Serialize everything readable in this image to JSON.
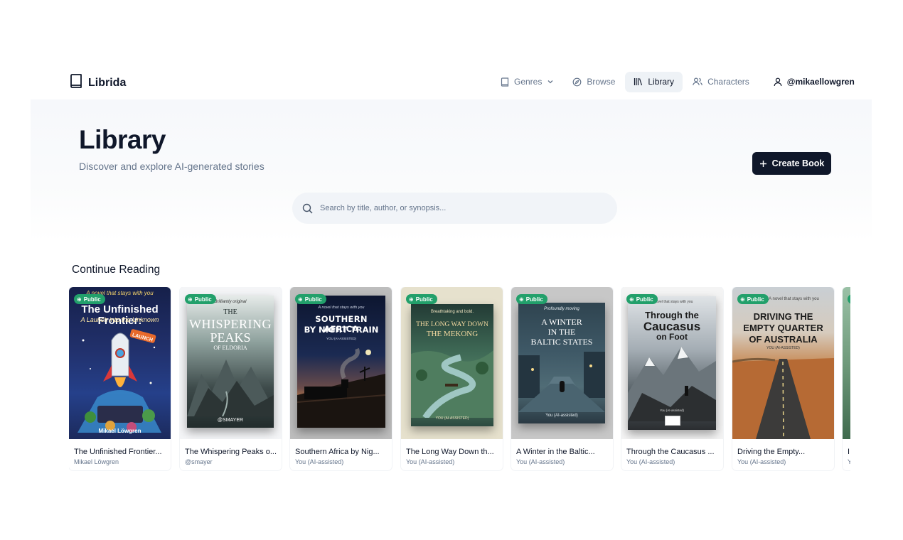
{
  "app": {
    "brand": "Librida"
  },
  "nav": {
    "genres": "Genres",
    "browse": "Browse",
    "library": "Library",
    "characters": "Characters",
    "user": "@mikaellowgren"
  },
  "hero": {
    "title": "Library",
    "subtitle": "Discover and explore AI-generated stories",
    "create_label": "Create Book"
  },
  "search": {
    "placeholder": "Search by title, author, or synopsis..."
  },
  "continue": {
    "heading": "Continue Reading"
  },
  "badge_label": "Public",
  "books": [
    {
      "title": "The Unfinished Frontier...",
      "author": "Mikael Löwgren",
      "cover": {
        "quote": "A novel that stays with you",
        "line1": "The Unfinished Frontier:",
        "line2": "A Launch into the Unknown",
        "tag": "LAUNCH",
        "footer": "Mikael Löwgren"
      }
    },
    {
      "title": "The Whispering Peaks o...",
      "author": "@smayer",
      "cover": {
        "quote": "Brilliantly original",
        "line1": "THE",
        "line2": "WHISPERING",
        "line3": "PEAKS",
        "line4": "OF ELDORIA",
        "footer": "@SMAYER"
      }
    },
    {
      "title": "Southern Africa by Nig...",
      "author": "You (AI-assisted)",
      "cover": {
        "quote": "A novel that stays with you",
        "line1": "SOUTHERN AFRICA",
        "line2": "BY NIGHT TRAIN",
        "footer": "YOU (AI-ASSISTED)"
      }
    },
    {
      "title": "The Long Way Down th...",
      "author": "You (AI-assisted)",
      "cover": {
        "quote": "Breathtaking and bold.",
        "line1": "THE LONG WAY DOWN",
        "line2": "THE MEKONG",
        "footer": "YOU (AI-ASSISTED)"
      }
    },
    {
      "title": "A Winter in the Baltic...",
      "author": "You (AI-assisted)",
      "cover": {
        "quote": "Profoundly moving",
        "line1": "A WINTER",
        "line2": "IN THE",
        "line3": "BALTIC STATES",
        "footer": "You (AI-assisted)"
      }
    },
    {
      "title": "Through the Caucasus ...",
      "author": "You (AI-assisted)",
      "cover": {
        "quote": "A novel that stays with you",
        "line1": "Through the",
        "line2": "Caucasus",
        "line3": "on Foot",
        "footer": "You (AI-assisted)"
      }
    },
    {
      "title": "Driving the Empty...",
      "author": "You (AI-assisted)",
      "cover": {
        "quote": "A novel that stays with you",
        "line1": "DRIVING THE",
        "line2": "EMPTY QUARTER",
        "line3": "OF AUSTRALIA",
        "footer": "YOU (AI-ASSISTED)"
      }
    },
    {
      "title": "I",
      "author": "Y",
      "cover": {}
    }
  ]
}
